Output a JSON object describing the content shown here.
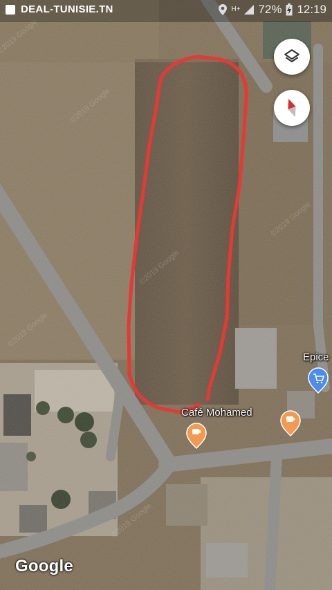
{
  "status_bar": {
    "app_label": "DEAL-TUNISIE.TN",
    "network": "H+",
    "battery": "72%",
    "time": "12:19"
  },
  "map": {
    "attribution": "Google",
    "watermark": "©2019 Google",
    "pois": [
      {
        "name": "Café Mohamed",
        "icon": "cafe-icon",
        "color": "#f29b50"
      },
      {
        "name": "Epice",
        "icon": "shopping-cart-icon",
        "color": "#4a8cf0"
      }
    ],
    "controls": [
      {
        "name": "layers-button",
        "icon": "layers-icon"
      },
      {
        "name": "compass-button",
        "icon": "compass-icon"
      }
    ],
    "route_color": "#e53935"
  }
}
